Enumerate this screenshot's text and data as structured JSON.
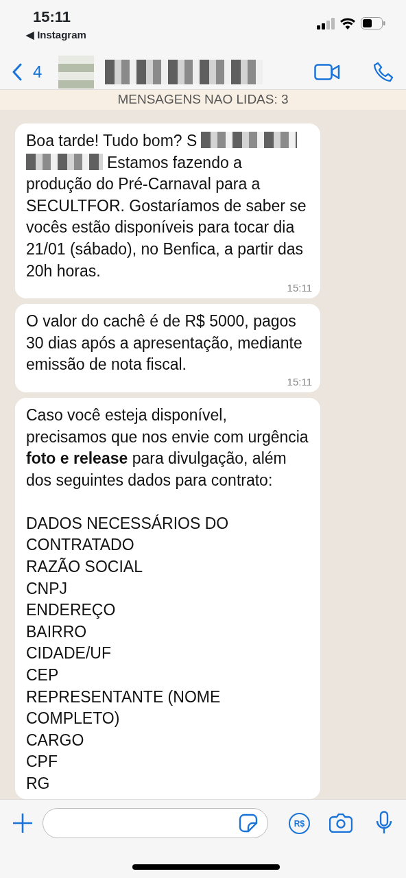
{
  "status_bar": {
    "time": "15:11",
    "back_app": "◀ Instagram"
  },
  "header": {
    "back_count": "4"
  },
  "unread_banner": "MENSAGENS NAO LIDAS: 3",
  "messages": [
    {
      "time": "15:11",
      "parts": [
        {
          "kind": "text",
          "text": "Boa tarde! Tudo bom? S"
        },
        {
          "kind": "redacted"
        },
        {
          "kind": "redacted"
        },
        {
          "kind": "text",
          "text": "Estamos fazendo a"
        },
        {
          "kind": "text",
          "text": "produção do Pré-Carnaval para a SECULTFOR. Gostaríamos de saber se vocês estão disponíveis para tocar dia 21/01 (sábado), no Benfica, a partir das 20h horas."
        }
      ]
    },
    {
      "time": "15:11",
      "parts": [
        {
          "kind": "text",
          "text": "O valor do cachê é de R$ 5000, pagos 30 dias após a apresentação, mediante emissão de nota fiscal."
        }
      ]
    },
    {
      "parts": [
        {
          "kind": "text",
          "text": "Caso você esteja disponível, precisamos que nos envie com urgência **foto e release** para divulgação, além dos seguintes dados para contrato:"
        }
      ],
      "lines": [
        "DADOS NECESSÁRIOS DO CONTRATADO",
        "RAZÃO SOCIAL",
        "CNPJ",
        "ENDEREÇO",
        "BAIRRO",
        "CIDADE/UF",
        "CEP",
        "REPRESENTANTE (NOME COMPLETO)",
        "CARGO",
        "CPF",
        "RG"
      ]
    }
  ],
  "composer": {
    "payment_label": "R$"
  }
}
